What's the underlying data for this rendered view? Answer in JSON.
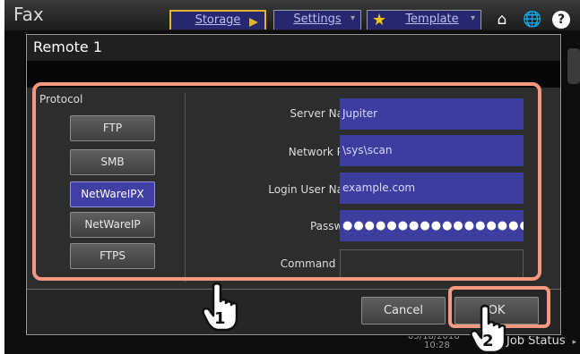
{
  "app": {
    "title": "Fax",
    "tabs": [
      {
        "label": "Storage"
      },
      {
        "label": "Settings"
      },
      {
        "label": "Template"
      }
    ],
    "bottom_status": "Job Status",
    "bottom_time": [
      "05/18/2016",
      "10:28"
    ]
  },
  "dialog": {
    "title": "Remote 1",
    "protocol_label": "Protocol",
    "protocols": [
      {
        "label": "FTP",
        "selected": false
      },
      {
        "label": "SMB",
        "selected": false
      },
      {
        "label": "NetWareIPX",
        "selected": true
      },
      {
        "label": "NetWareIP",
        "selected": false
      },
      {
        "label": "FTPS",
        "selected": false
      }
    ],
    "fields": [
      {
        "label": "Server Name",
        "value": "Jupiter"
      },
      {
        "label": "Network Path",
        "value": "\\sys\\scan"
      },
      {
        "label": "Login User Name",
        "value": "example.com"
      },
      {
        "label": "Password",
        "value": "●●●●●●●●●●●●●●●●●"
      },
      {
        "label": "Command Port",
        "value": ""
      }
    ],
    "cancel_label": "Cancel",
    "ok_label": "OK"
  },
  "annotations": {
    "callout_1": "1",
    "callout_2": "2",
    "highlight_color": "#f4987e"
  },
  "colors": {
    "selected_button": "#3f3fa6",
    "field_background": "#3d3da0",
    "tab_highlight": "#e3b230"
  }
}
